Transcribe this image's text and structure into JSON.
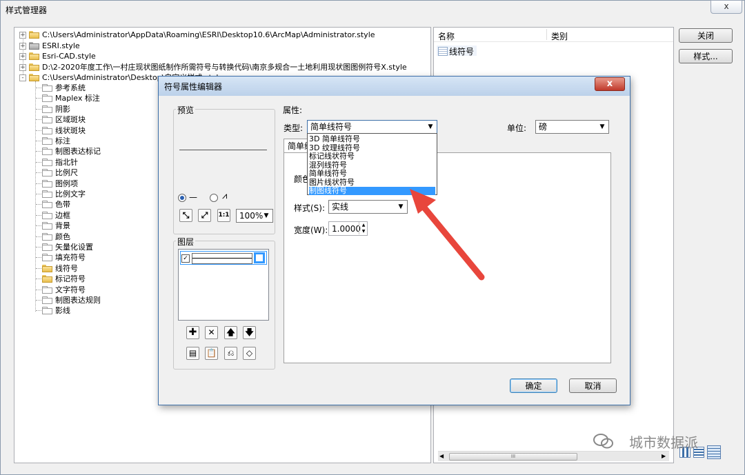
{
  "main": {
    "title": "样式管理器",
    "close_top": "x",
    "buttons": {
      "close": "关闭",
      "styles": "样式..."
    },
    "tree": [
      {
        "label": "C:\\Users\\Administrator\\AppData\\Roaming\\ESRI\\Desktop10.6\\ArcMap\\Administrator.style",
        "expander": "+",
        "folder": "yellow"
      },
      {
        "label": "ESRI.style",
        "expander": "+",
        "folder": "grey"
      },
      {
        "label": "Esri-CAD.style",
        "expander": "+",
        "folder": "yellow"
      },
      {
        "label": "D:\\2-2020年度工作\\一村庄现状图纸制作所需符号与转换代码\\南京多规合一土地利用现状图图例符号X.style",
        "expander": "+",
        "folder": "yellow"
      },
      {
        "label": "C:\\Users\\Administrator\\Desktop\\自定义样式.style",
        "expander": "-",
        "folder": "yellow"
      }
    ],
    "subfolders": [
      "参考系统",
      "Maplex 标注",
      "阴影",
      "区域斑块",
      "线状斑块",
      "标注",
      "制图表达标记",
      "指北针",
      "比例尺",
      "图例项",
      "比例文字",
      "色带",
      "边框",
      "背景",
      "颜色",
      "矢量化设置",
      "填充符号",
      "线符号",
      "标记符号",
      "文字符号",
      "制图表达规则",
      "影线"
    ],
    "list": {
      "col_name": "名称",
      "col_category": "类别",
      "items": [
        "线符号"
      ]
    },
    "watermark": "城市数据派",
    "scroll_grip": "III"
  },
  "dialog": {
    "title": "符号属性编辑器",
    "close": "x",
    "preview_label": "预览",
    "zoom": "100%",
    "layers_label": "图层",
    "properties_label": "属性:",
    "type_label": "类型:",
    "type_value": "简单线符号",
    "unit_label": "单位:",
    "unit_value": "磅",
    "tab_partial": "简单线",
    "color_partial": "颜色",
    "style_label": "样式(S):",
    "style_value": "实线",
    "width_label": "宽度(W):",
    "width_value": "1.0000",
    "ok": "确定",
    "cancel": "取消",
    "dropdown_items": [
      "3D 简单线符号",
      "3D 纹理线符号",
      "标记线状符号",
      "混列线符号",
      "简单线符号",
      "图片线状符号",
      "制图线符号"
    ],
    "selected_index": 6,
    "preview_buttons": [
      "fit",
      "full",
      "1:1"
    ],
    "layer_buttons": [
      "add",
      "remove",
      "up",
      "down"
    ]
  },
  "colors": {
    "selection": "#3399ff",
    "arrow": "#e8463c",
    "close_red": "#c0392b"
  }
}
